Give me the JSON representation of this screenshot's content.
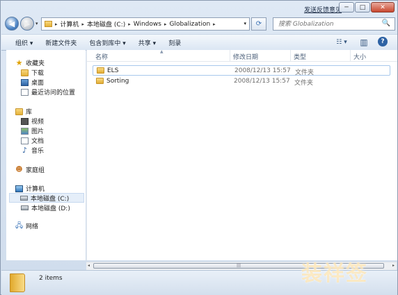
{
  "title_bar": {
    "feedback_link": "发送反馈意见",
    "minimize": "─",
    "maximize": "□",
    "close": "✕"
  },
  "nav": {
    "back_icon": "back-arrow-icon",
    "forward_icon": "forward-arrow-icon",
    "recent_dropdown": "▾"
  },
  "address": {
    "breadcrumbs": [
      "计算机",
      "本地磁盘 (C:)",
      "Windows",
      "Globalization"
    ],
    "separator": "▸",
    "dropdown": "▾"
  },
  "refresh": {
    "icon": "⟳"
  },
  "search": {
    "placeholder": "搜索 Globalization",
    "icon": "🔍"
  },
  "toolbar": {
    "organize": "组织 ▾",
    "new_folder": "新建文件夹",
    "include_in_library": "包含到库中 ▾",
    "share": "共享 ▾",
    "burn": "刻录",
    "view_icon": "☷ ▾",
    "preview_icon": "▥",
    "help_icon": "?"
  },
  "sidebar": {
    "favorites": {
      "label": "收藏夹",
      "items": [
        "下载",
        "桌面",
        "最近访问的位置"
      ]
    },
    "libraries": {
      "label": "库",
      "items": [
        "视频",
        "图片",
        "文档",
        "音乐"
      ]
    },
    "homegroup": "家庭组",
    "computer": {
      "label": "计算机",
      "items": [
        "本地磁盘 (C:)",
        "本地磁盘 (D:)"
      ]
    },
    "network": "网络"
  },
  "columns": {
    "name": "名称",
    "date": "修改日期",
    "type": "类型",
    "size": "大小"
  },
  "files": [
    {
      "name": "ELS",
      "date": "2008/12/13 15:57",
      "type": "文件夹",
      "size": ""
    },
    {
      "name": "Sorting",
      "date": "2008/12/13 15:57",
      "type": "文件夹",
      "size": ""
    }
  ],
  "scrollbar": {
    "left_arrow": "◂",
    "right_arrow": "▸",
    "grip": "|||"
  },
  "status": {
    "item_count": "2 items"
  },
  "watermark": "装祥签"
}
